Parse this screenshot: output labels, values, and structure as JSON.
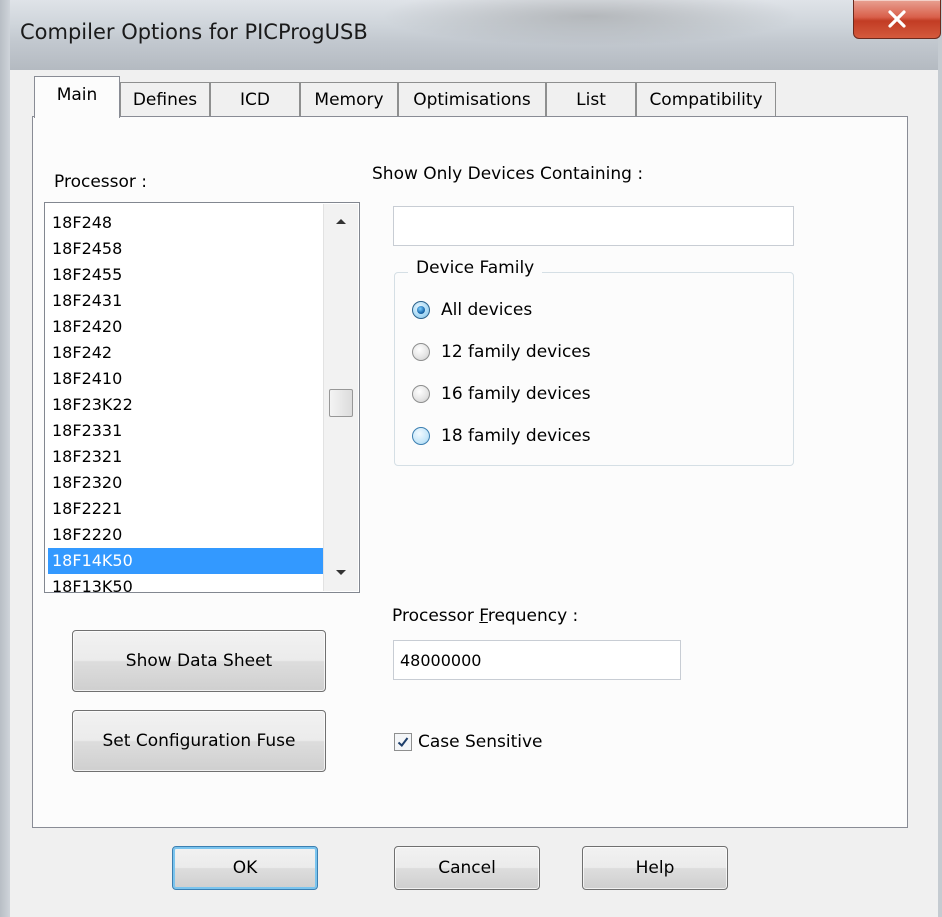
{
  "window": {
    "title": "Compiler Options for PICProgUSB"
  },
  "tabs": [
    {
      "label": "Main",
      "active": true
    },
    {
      "label": "Defines"
    },
    {
      "label": "ICD"
    },
    {
      "label": "Memory"
    },
    {
      "label": "Optimisations"
    },
    {
      "label": "List"
    },
    {
      "label": "Compatibility"
    }
  ],
  "main": {
    "processor_label": "Processor :",
    "processor_list": [
      "18F248",
      "18F2458",
      "18F2455",
      "18F2431",
      "18F2420",
      "18F242",
      "18F2410",
      "18F23K22",
      "18F2331",
      "18F2321",
      "18F2320",
      "18F2221",
      "18F2220",
      "18F14K50",
      "18F13K50"
    ],
    "processor_selected": "18F14K50",
    "filter_label": "Show Only Devices Containing :",
    "filter_value": "",
    "device_family": {
      "legend": "Device Family",
      "options": [
        {
          "label": "All devices",
          "checked": true
        },
        {
          "label": "12 family devices"
        },
        {
          "label": "16 family devices"
        },
        {
          "label": "18 family devices"
        }
      ]
    },
    "show_data_sheet_label": "Show Data Sheet",
    "set_config_fuse_label": "Set Configuration Fuse",
    "frequency_label_prefix": "Processor ",
    "frequency_label_accel": "F",
    "frequency_label_suffix": "requency :",
    "frequency_value": "48000000",
    "case_sensitive_label": "Case Sensitive",
    "case_sensitive_checked": true
  },
  "footer": {
    "ok_label": "OK",
    "cancel_label": "Cancel",
    "help_label": "Help"
  },
  "colors": {
    "selection": "#3399ff",
    "close_button": "#c23c24",
    "default_button_border": "#3c7fb1"
  }
}
